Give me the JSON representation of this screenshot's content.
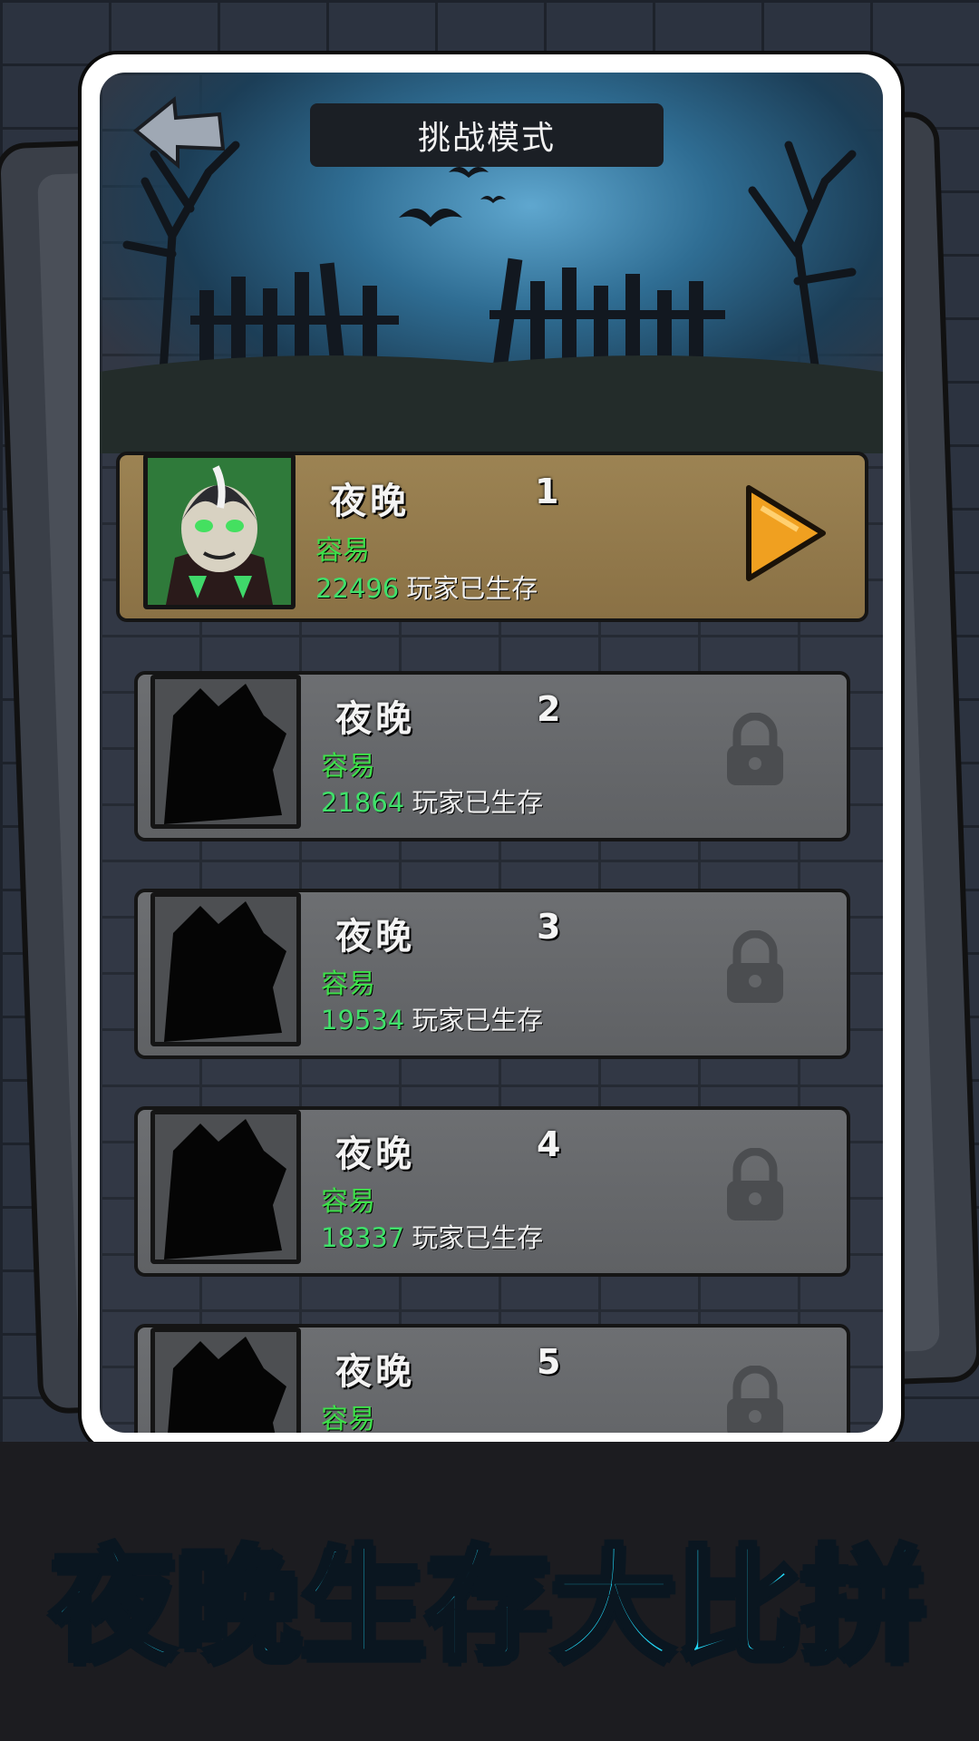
{
  "header": {
    "title": "挑战模式",
    "back_icon": "back-arrow-icon"
  },
  "levels": [
    {
      "name": "夜晚",
      "number": "1",
      "difficulty": "容易",
      "survivors": "22496",
      "survivors_label": "玩家已生存",
      "locked": false
    },
    {
      "name": "夜晚",
      "number": "2",
      "difficulty": "容易",
      "survivors": "21864",
      "survivors_label": "玩家已生存",
      "locked": true
    },
    {
      "name": "夜晚",
      "number": "3",
      "difficulty": "容易",
      "survivors": "19534",
      "survivors_label": "玩家已生存",
      "locked": true
    },
    {
      "name": "夜晚",
      "number": "4",
      "difficulty": "容易",
      "survivors": "18337",
      "survivors_label": "玩家已生存",
      "locked": true
    },
    {
      "name": "夜晚",
      "number": "5",
      "difficulty": "容易",
      "locked": true
    }
  ],
  "slogan": "夜晚生存大比拼",
  "colors": {
    "difficulty": "#3ee04a",
    "survivors": "#40e06a",
    "slogan": "#22d8f7",
    "play": "#f0a020"
  }
}
